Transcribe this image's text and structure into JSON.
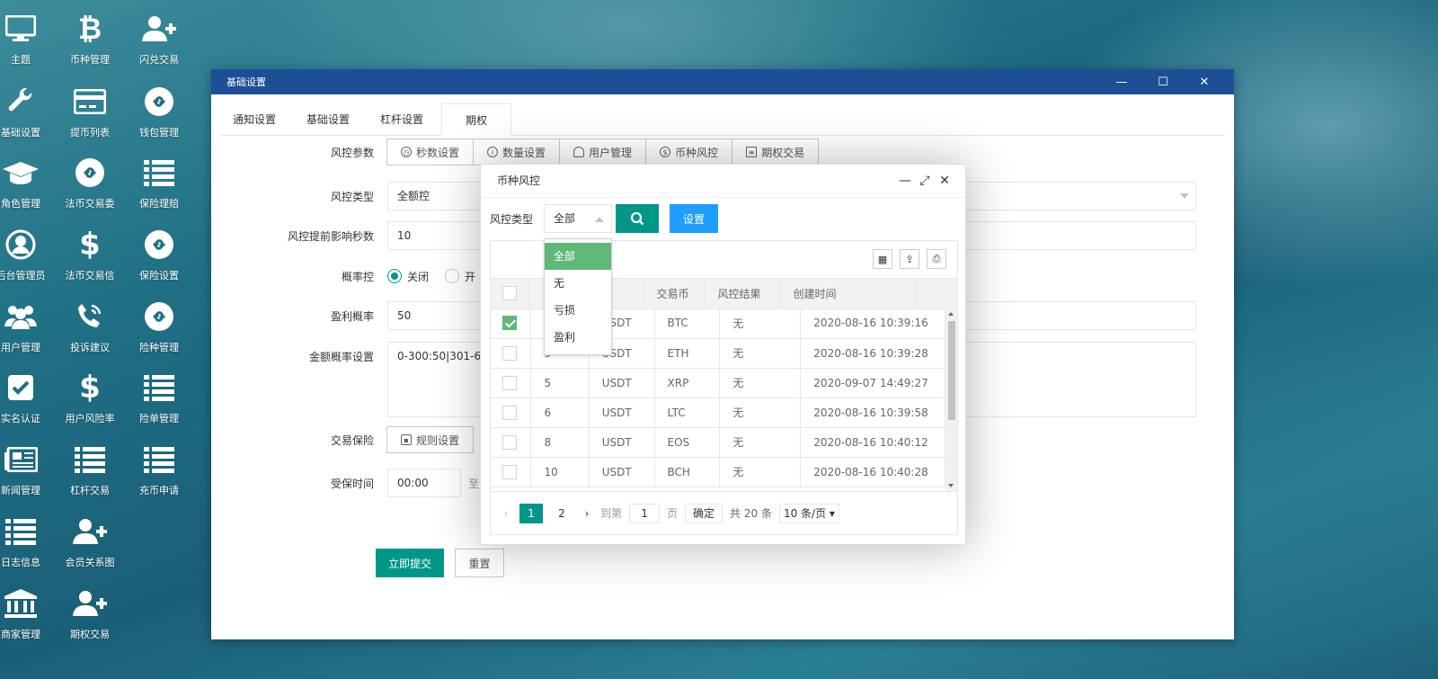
{
  "desktop": [
    {
      "label": "主题",
      "icon": "monitor-icon"
    },
    {
      "label": "币种管理",
      "icon": "bitcoin-icon"
    },
    {
      "label": "闪兑交易",
      "icon": "add-user-icon"
    },
    {
      "label": "基础设置",
      "icon": "wrench-icon"
    },
    {
      "label": "提币列表",
      "icon": "credit-card-icon"
    },
    {
      "label": "钱包管理",
      "icon": "link-circle-icon"
    },
    {
      "label": "角色管理",
      "icon": "graduation-cap-icon"
    },
    {
      "label": "法币交易委",
      "icon": "link-circle-icon"
    },
    {
      "label": "保险理赔",
      "icon": "list-icon"
    },
    {
      "label": "后台管理员",
      "icon": "user-circle-icon"
    },
    {
      "label": "法币交易信",
      "icon": "dollar-icon"
    },
    {
      "label": "保险设置",
      "icon": "link-circle-icon"
    },
    {
      "label": "用户管理",
      "icon": "users-icon"
    },
    {
      "label": "投诉建议",
      "icon": "phone-icon"
    },
    {
      "label": "险种管理",
      "icon": "link-circle-icon"
    },
    {
      "label": "实名认证",
      "icon": "checkbox-icon"
    },
    {
      "label": "用户风险率",
      "icon": "dollar-icon"
    },
    {
      "label": "险单管理",
      "icon": "list-icon"
    },
    {
      "label": "新闻管理",
      "icon": "newspaper-icon"
    },
    {
      "label": "杠杆交易",
      "icon": "list-icon"
    },
    {
      "label": "充币申请",
      "icon": "list-icon"
    },
    {
      "label": "日志信息",
      "icon": "list-icon"
    },
    {
      "label": "会员关系图",
      "icon": "add-user-icon"
    },
    {
      "label": "商家管理",
      "icon": "bank-icon"
    },
    {
      "label": "期权交易",
      "icon": "add-user-icon"
    }
  ],
  "window": {
    "title": "基础设置",
    "controls": {
      "minimize": "—",
      "maximize": "☐",
      "close": "✕"
    },
    "tabs": [
      "通知设置",
      "基础设置",
      "杠杆设置",
      "期权"
    ],
    "active_tab": 3
  },
  "form": {
    "risk_params_label": "风控参数",
    "risk_buttons": [
      "秒数设置",
      "数量设置",
      "用户管理",
      "币种风控",
      "期权交易"
    ],
    "risk_type_label": "风控类型",
    "risk_type_value": "全额控",
    "advance_label": "风控提前影响秒数",
    "advance_value": "10",
    "prob_label": "概率控",
    "prob_off": "关闭",
    "prob_on": "开",
    "profit_label": "盈利概率",
    "profit_value": "50",
    "amount_label": "金额概率设置",
    "amount_value": "0-300:50|301-600",
    "insurance_label": "交易保险",
    "insurance_button": "规则设置",
    "time_label": "受保时间",
    "time_value": "00:00",
    "time_sep": "至",
    "submit": "立即提交",
    "reset": "重置"
  },
  "modal": {
    "title": "币种风控",
    "filter_label": "风控类型",
    "filter_value": "全部",
    "set_button": "设置",
    "dropdown": [
      "全部",
      "无",
      "亏损",
      "盈利"
    ],
    "columns": [
      "",
      "",
      "币",
      "交易币",
      "风控结果",
      "创建时间"
    ],
    "rows": [
      {
        "id": "",
        "base": "USDT",
        "coin": "BTC",
        "result": "无",
        "time": "2020-08-16 10:39:16",
        "checked": true
      },
      {
        "id": "3",
        "base": "USDT",
        "coin": "ETH",
        "result": "无",
        "time": "2020-08-16 10:39:28",
        "checked": false
      },
      {
        "id": "5",
        "base": "USDT",
        "coin": "XRP",
        "result": "无",
        "time": "2020-09-07 14:49:27",
        "checked": false
      },
      {
        "id": "6",
        "base": "USDT",
        "coin": "LTC",
        "result": "无",
        "time": "2020-08-16 10:39:58",
        "checked": false
      },
      {
        "id": "8",
        "base": "USDT",
        "coin": "EOS",
        "result": "无",
        "time": "2020-08-16 10:40:12",
        "checked": false
      },
      {
        "id": "10",
        "base": "USDT",
        "coin": "BCH",
        "result": "无",
        "time": "2020-08-16 10:40:28",
        "checked": false
      }
    ],
    "pager": {
      "pages": [
        "1",
        "2"
      ],
      "goto_label": "到第",
      "goto_value": "1",
      "page_unit": "页",
      "confirm": "确定",
      "total": "共 20 条",
      "page_size": "10 条/页"
    }
  },
  "colors": {
    "primary": "#009688",
    "blue": "#1e9fff",
    "title_bar": "#1d4f97",
    "checked": "#5fb878"
  }
}
